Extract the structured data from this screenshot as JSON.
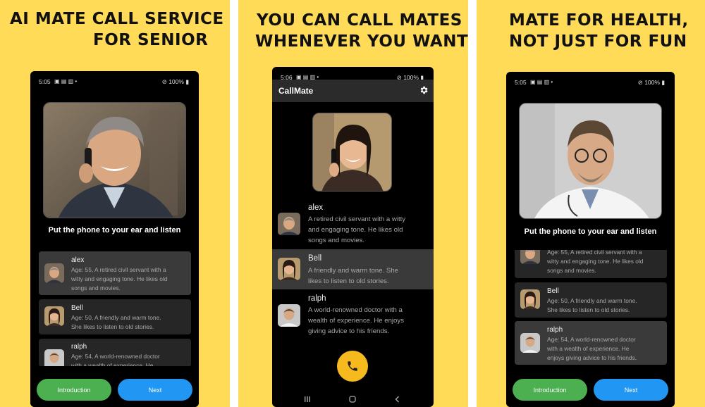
{
  "panels": [
    {
      "headline": [
        "AI MATE CALL SERVICE",
        "FOR SENIOR"
      ],
      "status": {
        "time": "5:05",
        "battery": "100%"
      },
      "caption": "Put the phone to your ear and listen",
      "cards": [
        {
          "name": "alex",
          "desc": [
            "Age: 55, A retired civil servant with a",
            "witty and engaging tone. He likes old",
            "songs and movies."
          ]
        },
        {
          "name": "Bell",
          "desc": [
            "Age: 50, A friendly and warm tone.",
            "She likes to listen to old stories."
          ]
        },
        {
          "name": "ralph",
          "desc": [
            "Age: 54, A world-renowned doctor",
            "with a wealth of experience. He"
          ]
        }
      ],
      "buttons": {
        "intro": "Introduction",
        "next": "Next"
      }
    },
    {
      "headline": [
        "YOU CAN CALL MATES",
        "WHENEVER YOU WANT"
      ],
      "status": {
        "time": "5:06",
        "battery": "100%"
      },
      "app_title": "CallMate",
      "cards": [
        {
          "name": "alex",
          "desc": [
            "A retired civil servant with a witty",
            "and engaging tone. He likes old",
            "songs and movies."
          ]
        },
        {
          "name": "Bell",
          "desc": [
            "A friendly and warm tone. She",
            "likes to listen to old stories."
          ]
        },
        {
          "name": "ralph",
          "desc": [
            "A world-renowned doctor with a",
            "wealth of experience. He enjoys",
            "giving advice to his friends."
          ]
        }
      ]
    },
    {
      "headline": [
        "MATE FOR HEALTH,",
        "NOT JUST FOR FUN"
      ],
      "status": {
        "time": "5:05",
        "battery": "100%"
      },
      "caption": "Put the phone to your ear and listen",
      "cards": [
        {
          "name": "",
          "desc": [
            "Age: 55, A retired civil servant with a",
            "witty and engaging tone. He likes old",
            "songs and movies."
          ]
        },
        {
          "name": "Bell",
          "desc": [
            "Age: 50, A friendly and warm tone.",
            "She likes to listen to old stories."
          ]
        },
        {
          "name": "ralph",
          "desc": [
            "Age: 54, A world-renowned doctor",
            "with a wealth of experience. He",
            "enjoys giving advice to his friends."
          ]
        }
      ],
      "buttons": {
        "intro": "Introduction",
        "next": "Next"
      }
    }
  ],
  "colors": {
    "background": "#FFDB58",
    "green": "#4CAF50",
    "blue": "#2196F3",
    "call": "#F6B91E"
  }
}
